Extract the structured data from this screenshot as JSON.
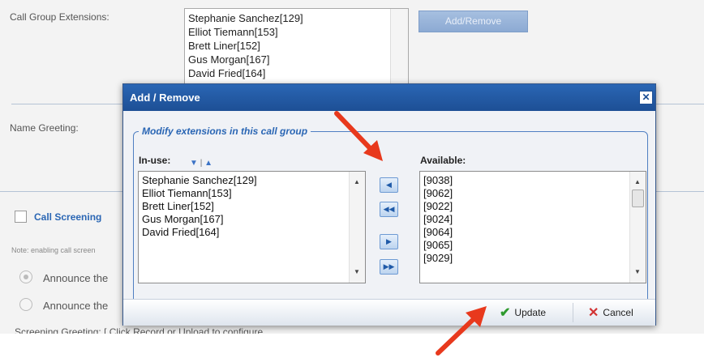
{
  "background": {
    "call_group_label": "Call Group Extensions:",
    "extensions": [
      "Stephanie Sanchez[129]",
      "Elliot Tiemann[153]",
      "Brett Liner[152]",
      "Gus Morgan[167]",
      "David Fried[164]"
    ],
    "add_remove_label": "Add/Remove",
    "name_greeting_label": "Name Greeting:",
    "call_screening_label": "Call Screening",
    "note_text": "Note: enabling call screen",
    "announce_1": "Announce the",
    "announce_2": "Announce the",
    "screening_greeting_text": "Screening Greeting:  [ Click Record or Upload to configure"
  },
  "dialog": {
    "title": "Add / Remove",
    "close_glyph": "✕",
    "legend": "Modify extensions in this call group",
    "in_use_label": "In-use:",
    "available_label": "Available:",
    "in_use_items": [
      "Stephanie Sanchez[129]",
      "Elliot Tiemann[153]",
      "Brett Liner[152]",
      "Gus Morgan[167]",
      "David Fried[164]"
    ],
    "available_items": [
      "[9038]",
      "[9062]",
      "[9022]",
      "[9024]",
      "[9064]",
      "[9065]",
      "[9029]"
    ],
    "update_label": "Update",
    "cancel_label": "Cancel"
  },
  "colors": {
    "accent": "#2a66b4",
    "annotation_arrow": "#e8391d",
    "update_check": "#2e9a2e",
    "cancel_x": "#d23232"
  }
}
